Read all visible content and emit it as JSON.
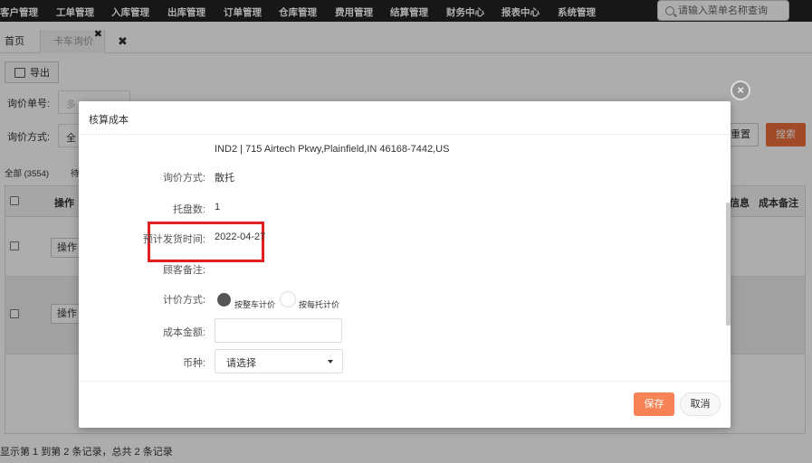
{
  "nav": {
    "items": [
      "客户管理",
      "工单管理",
      "入库管理",
      "出库管理",
      "订单管理",
      "仓库管理",
      "费用管理",
      "结算管理",
      "财务中心",
      "报表中心",
      "系统管理"
    ],
    "search_placeholder": "请输入菜单名称查询"
  },
  "tabs": {
    "home": "首页",
    "current": "卡车询价",
    "close_glyph": "✖"
  },
  "page": {
    "export_label": "导出",
    "filters": {
      "order_no_label": "询价单号:",
      "order_no_placeholder": "多",
      "method_label": "询价方式:",
      "method_value": "全"
    },
    "reset_label": "重置",
    "search_label": "搜索",
    "status_tab": "全部 (3554)",
    "status_tab2": "待",
    "columns": {
      "action": "操作",
      "info": "信息",
      "cost_note": "成本备注"
    },
    "row_action_label": "操作",
    "pager_text": "显示第 1 到第 2 条记录，总共 2 条记录"
  },
  "modal": {
    "title": "核算成本",
    "close_glyph": "×",
    "address": "IND2 | 715 Airtech Pkwy,Plainfield,IN 46168-7442,US",
    "fields": {
      "inquiry_method_label": "询价方式:",
      "inquiry_method_value": "散托",
      "pallet_count_label": "托盘数:",
      "pallet_count_value": "1",
      "ship_date_label": "预计发货时间:",
      "ship_date_value": "2022-04-27",
      "customer_note_label": "顾客备注:",
      "customer_note_value": "",
      "pricing_method_label": "计价方式:",
      "pricing_option_full_truck": "按整车计价",
      "pricing_option_per_pallet": "按每托计价",
      "pricing_selected": "按整车计价",
      "cost_amount_label": "成本金额:",
      "cost_amount_value": "",
      "currency_label": "币种:",
      "currency_value": "请选择"
    },
    "save_label": "保存",
    "cancel_label": "取消"
  }
}
